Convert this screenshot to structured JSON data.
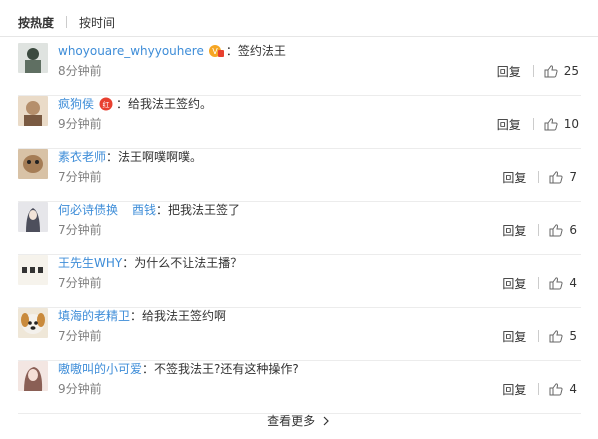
{
  "tabs": [
    {
      "label": "按热度",
      "active": true
    },
    {
      "label": "按时间",
      "active": false
    }
  ],
  "reply_label": "回复",
  "comments": [
    {
      "user": "whoyouare_whyyouhere",
      "sep": "：",
      "text": "签约法王",
      "time": "8分钟前",
      "likes": "25",
      "badge": "vip-badge-icon",
      "avatar_color": "#6b7b6a"
    },
    {
      "user": "疯狗侯",
      "sep": "：",
      "text": "给我法王签约。",
      "time": "9分钟前",
      "likes": "10",
      "badge": "red-badge-icon",
      "avatar_color": "#b58f6c"
    },
    {
      "user": "素衣老师",
      "sep": "：",
      "text": "法王啊噗啊噗。",
      "time": "7分钟前",
      "likes": "7",
      "avatar_color": "#c7a27a"
    },
    {
      "user": "何必诗债换",
      "user2": "酉钱",
      "sep": "：",
      "text": "把我法王签了",
      "time": "7分钟前",
      "likes": "6",
      "avatar_color": "#8d8f99"
    },
    {
      "user": "王先生WHY",
      "sep": "：",
      "text": "为什么不让法王播？",
      "time": "7分钟前",
      "likes": "4",
      "avatar_color": "#f3f0e8"
    },
    {
      "user": "填海的老精卫",
      "sep": "：",
      "text": "给我法王签约啊",
      "time": "7分钟前",
      "likes": "5",
      "avatar_color": "#d8c7a8"
    },
    {
      "user": "嗷嗷叫的小可爱",
      "sep": "：",
      "text": "不签我法王?还有这种操作?",
      "time": "9分钟前",
      "likes": "4",
      "avatar_color": "#e0c3bc"
    }
  ],
  "more_label": "查看更多",
  "colors": {
    "username": "#3e8dd8",
    "time": "#808080",
    "badge_red": "#e8402f",
    "badge_gold": "#f6a623"
  }
}
